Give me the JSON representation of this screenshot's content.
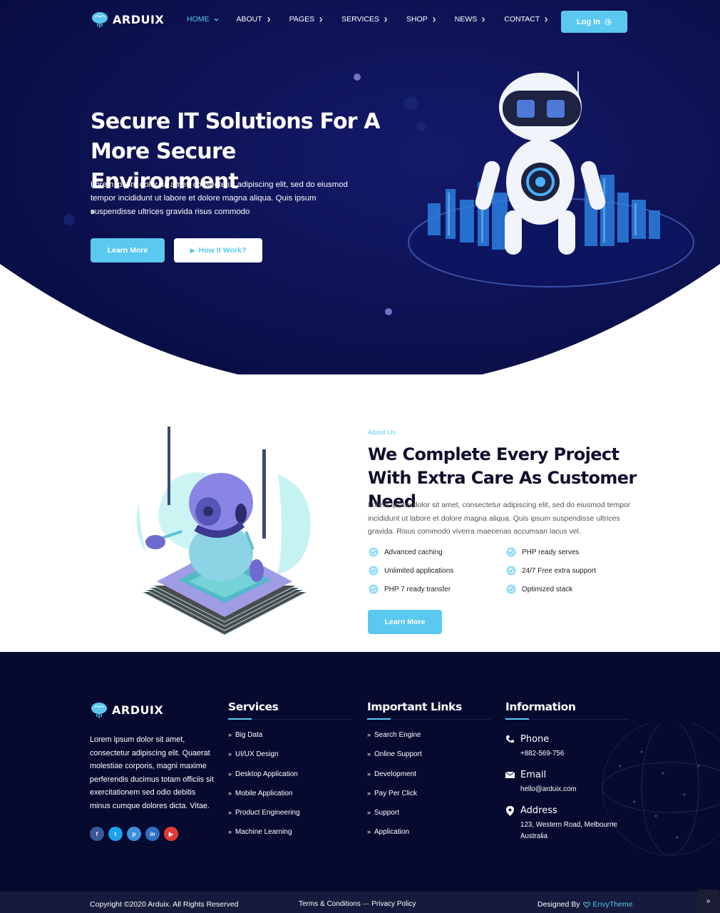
{
  "brand": {
    "name": "ARDUIX"
  },
  "nav": {
    "items": [
      {
        "label": "HOME"
      },
      {
        "label": "ABOUT"
      },
      {
        "label": "PAGES"
      },
      {
        "label": "SERVICES"
      },
      {
        "label": "SHOP"
      },
      {
        "label": "NEWS"
      },
      {
        "label": "CONTACT"
      }
    ],
    "active_index": 0,
    "login_label": "Log In"
  },
  "hero": {
    "title": "Secure IT Solutions For A More Secure Environment",
    "text": "Lorem ipsum dolor sit amet, consectetur adipiscing elit, sed do eiusmod tempor incididunt ut labore et dolore magna aliqua. Quis ipsum suspendisse ultrices gravida risus commodo",
    "primary_button": "Learn More",
    "secondary_button": "How It Work?"
  },
  "about": {
    "subtitle": "About Us",
    "title": "We Complete Every Project With Extra Care As Customer Need",
    "text": "Lorem ipsum dolor sit amet, consectetur adipiscing elit, sed do eiusmod tempor incididunt ut labore et dolore magna aliqua. Quis ipsum suspendisse ultrices gravida. Risus commodo viverra maecenas accumsan lacus vel.",
    "features": [
      "Advanced caching",
      "PHP ready serves",
      "Unlimited applications",
      "24/7 Free extra support",
      "PHP 7 ready transfer",
      "Optimized stack"
    ],
    "button": "Learn More"
  },
  "footer": {
    "about_text": "Lorem ipsum dolor sit amet, consectetur adipiscing elit. Quaerat molestiae corporis, magni maxime perferendis ducimus totam officiis sit exercitationem sed odio debitis minus cumque dolores dicta. Vitae.",
    "socials": [
      {
        "icon": "facebook-icon",
        "glyph": "f",
        "color": "#3b5998"
      },
      {
        "icon": "twitter-icon",
        "glyph": "t",
        "color": "#1da1f2"
      },
      {
        "icon": "pinterest-icon",
        "glyph": "p",
        "color": "#3f8fe0"
      },
      {
        "icon": "linkedin-icon",
        "glyph": "in",
        "color": "#2f6fc6"
      },
      {
        "icon": "youtube-icon",
        "glyph": "▶",
        "color": "#e53935"
      }
    ],
    "services": {
      "title": "Services",
      "links": [
        "Big Data",
        "UI/UX Design",
        "Desktop Application",
        "Mobile Application",
        "Product Engineering",
        "Machine Learning"
      ]
    },
    "important": {
      "title": "Important Links",
      "links": [
        "Search Engine",
        "Online Support",
        "Development",
        "Pay Per Click",
        "Support",
        "Application"
      ]
    },
    "information": {
      "title": "Information",
      "phone_label": "Phone",
      "phone": "+882-569-756",
      "email_label": "Email",
      "email": "hello@arduix.com",
      "address_label": "Address",
      "address": "123, Western Road, Melbourne Australia"
    },
    "copyright": "Copyright ©2020 Arduix. All Rights Reserved",
    "terms": "Terms & Conditions",
    "separator": "—",
    "privacy": "Privacy Policy",
    "designed_by": "Designed By",
    "designer": "EnvyTheme"
  },
  "colors": {
    "accent": "#5bc8ef",
    "hero_bg": "#0b0f4f",
    "footer_bg": "#060a2f"
  }
}
